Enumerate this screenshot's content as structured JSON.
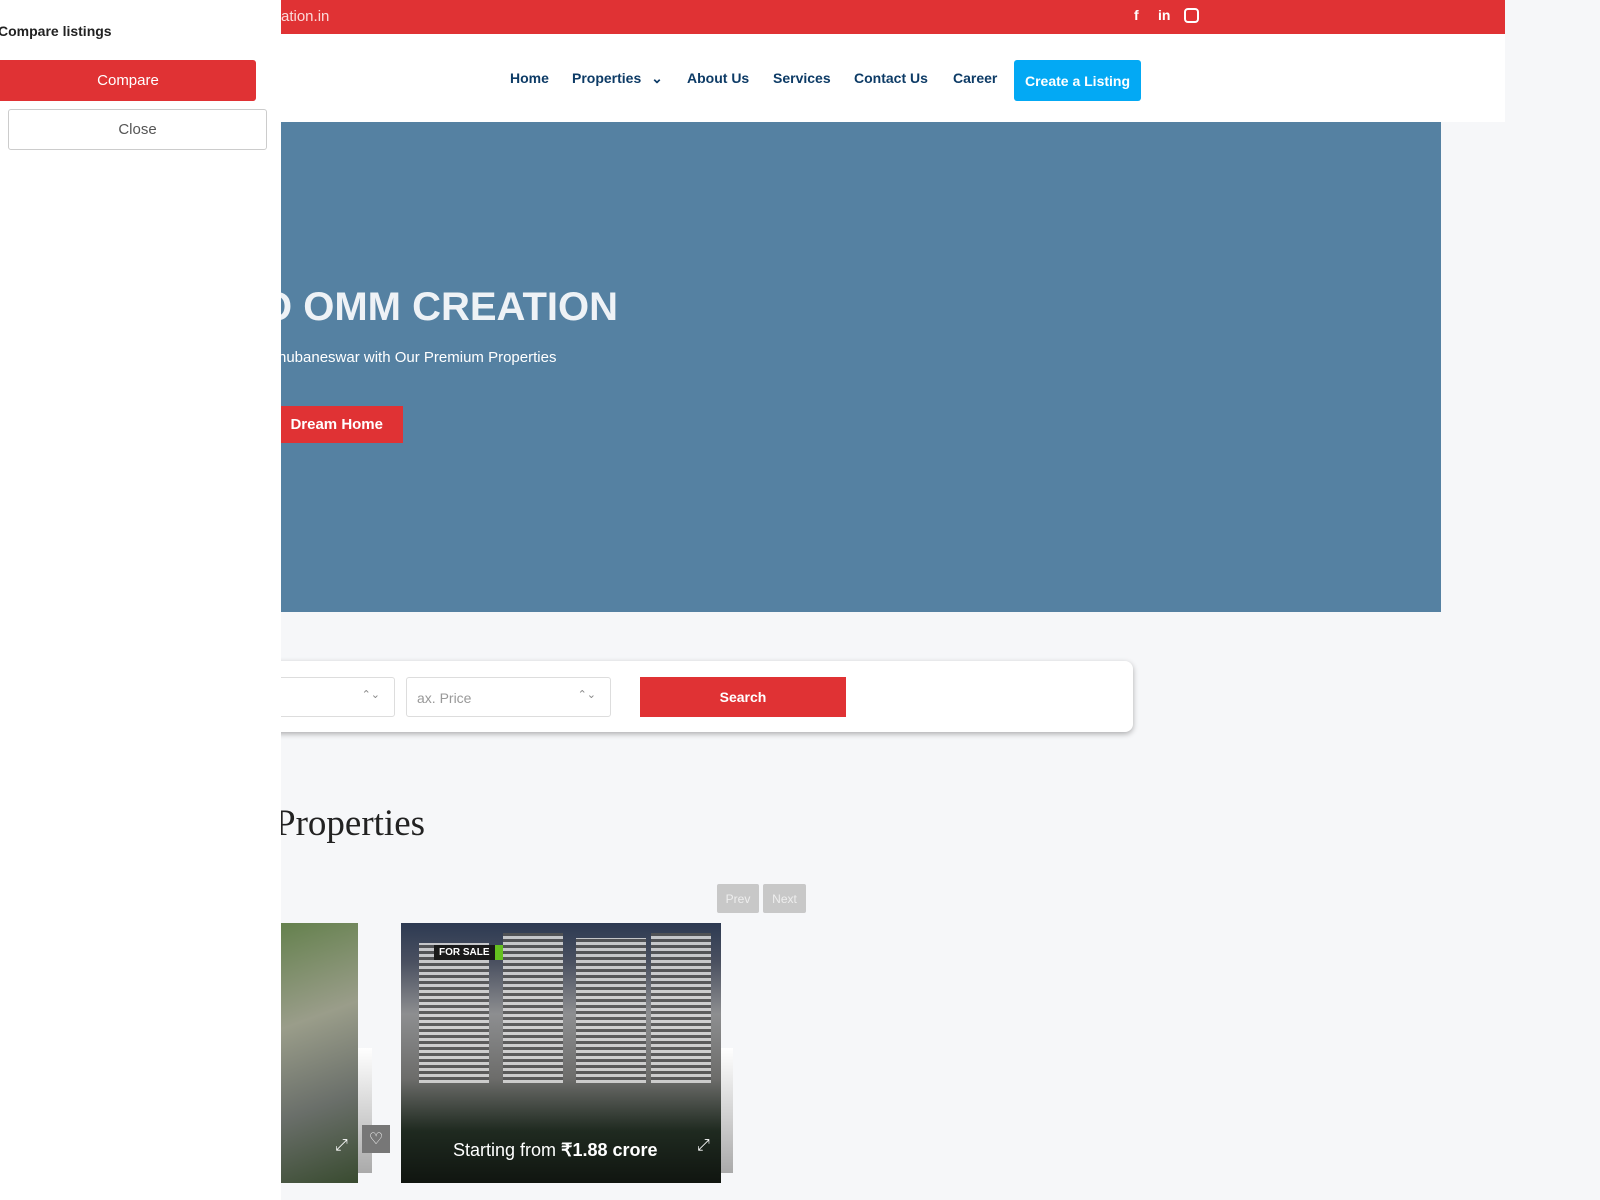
{
  "topbar": {
    "email_fragment": "ation.in",
    "social": [
      "facebook-icon",
      "linkedin-icon",
      "instagram-icon"
    ]
  },
  "nav": {
    "items": [
      "Home",
      "Properties",
      "About Us",
      "Services",
      "Contact Us",
      "Career"
    ],
    "create": "Create a Listing"
  },
  "hero": {
    "title": "O OMM CREATION",
    "subtitle": "hubaneswar with Our Premium Properties",
    "button": "Dream Home"
  },
  "search": {
    "max_price_placeholder": "ax. Price",
    "button": "Search"
  },
  "featured": {
    "title": "ured Properties",
    "prev": "Prev",
    "next": "Next",
    "cards": [
      {
        "badge": "FOR SALE",
        "price_prefix": "Starting from ",
        "price": "₹1.88 crore"
      }
    ]
  },
  "compare": {
    "title": "Compare listings",
    "compare": "Compare",
    "close": "Close"
  },
  "colors": {
    "brand_red": "#e03234",
    "hero_blue": "#5581a2",
    "cta_blue": "#03a9f4",
    "nav_text": "#0d3b66"
  }
}
